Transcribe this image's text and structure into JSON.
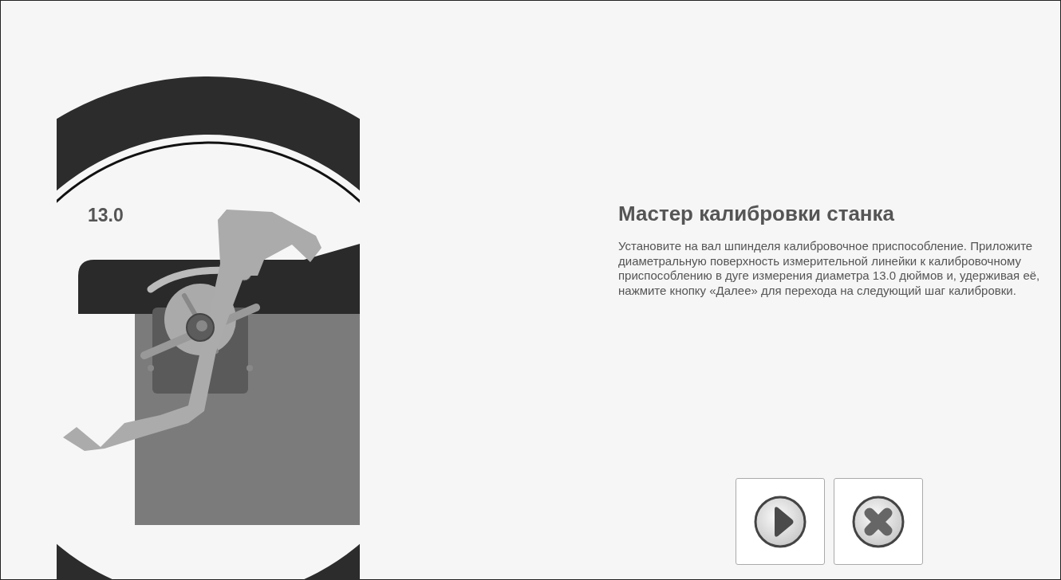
{
  "illustration": {
    "diameter_label": "13.0"
  },
  "title": "Мастер калибровки станка",
  "instructions": "Установите на вал шпинделя калибровочное приспособление. Приложите диаметральную поверхность измерительной линейки к калибровочному приспособлению в дуге измерения диаметра 13.0 дюймов и, удерживая её, нажмите кнопку «Далее» для перехода на следующий шаг калибровки.",
  "buttons": [
    {
      "kind": "next"
    },
    {
      "kind": "cancel"
    }
  ]
}
